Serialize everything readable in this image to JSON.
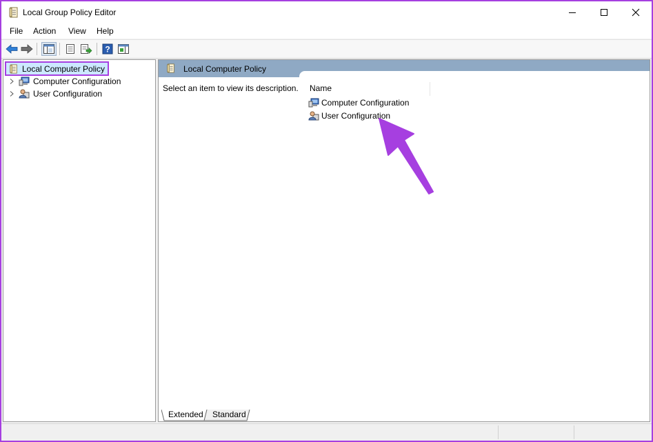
{
  "window": {
    "title": "Local Group Policy Editor",
    "icon": "policy-icon"
  },
  "menu": [
    "File",
    "Action",
    "View",
    "Help"
  ],
  "toolbar": [
    "back-icon",
    "forward-icon",
    "show-hide-tree-icon",
    "properties-icon",
    "export-list-icon",
    "help-icon",
    "show-hide-action-pane-icon"
  ],
  "tree": {
    "root": {
      "label": "Local Computer Policy",
      "icon": "policy-icon"
    },
    "children": [
      {
        "label": "Computer Configuration",
        "icon": "computer-icon"
      },
      {
        "label": "User Configuration",
        "icon": "user-icon"
      }
    ]
  },
  "right_pane": {
    "header": "Local Computer Policy",
    "description": "Select an item to view its description.",
    "column": "Name",
    "items": [
      {
        "label": "Computer Configuration",
        "icon": "computer-icon"
      },
      {
        "label": "User Configuration",
        "icon": "user-icon"
      }
    ],
    "tabs": [
      "Extended",
      "Standard"
    ]
  },
  "colors": {
    "highlight": "#a63fe0",
    "header_bg": "#8fa9c4",
    "selection": "#cce8ff"
  }
}
